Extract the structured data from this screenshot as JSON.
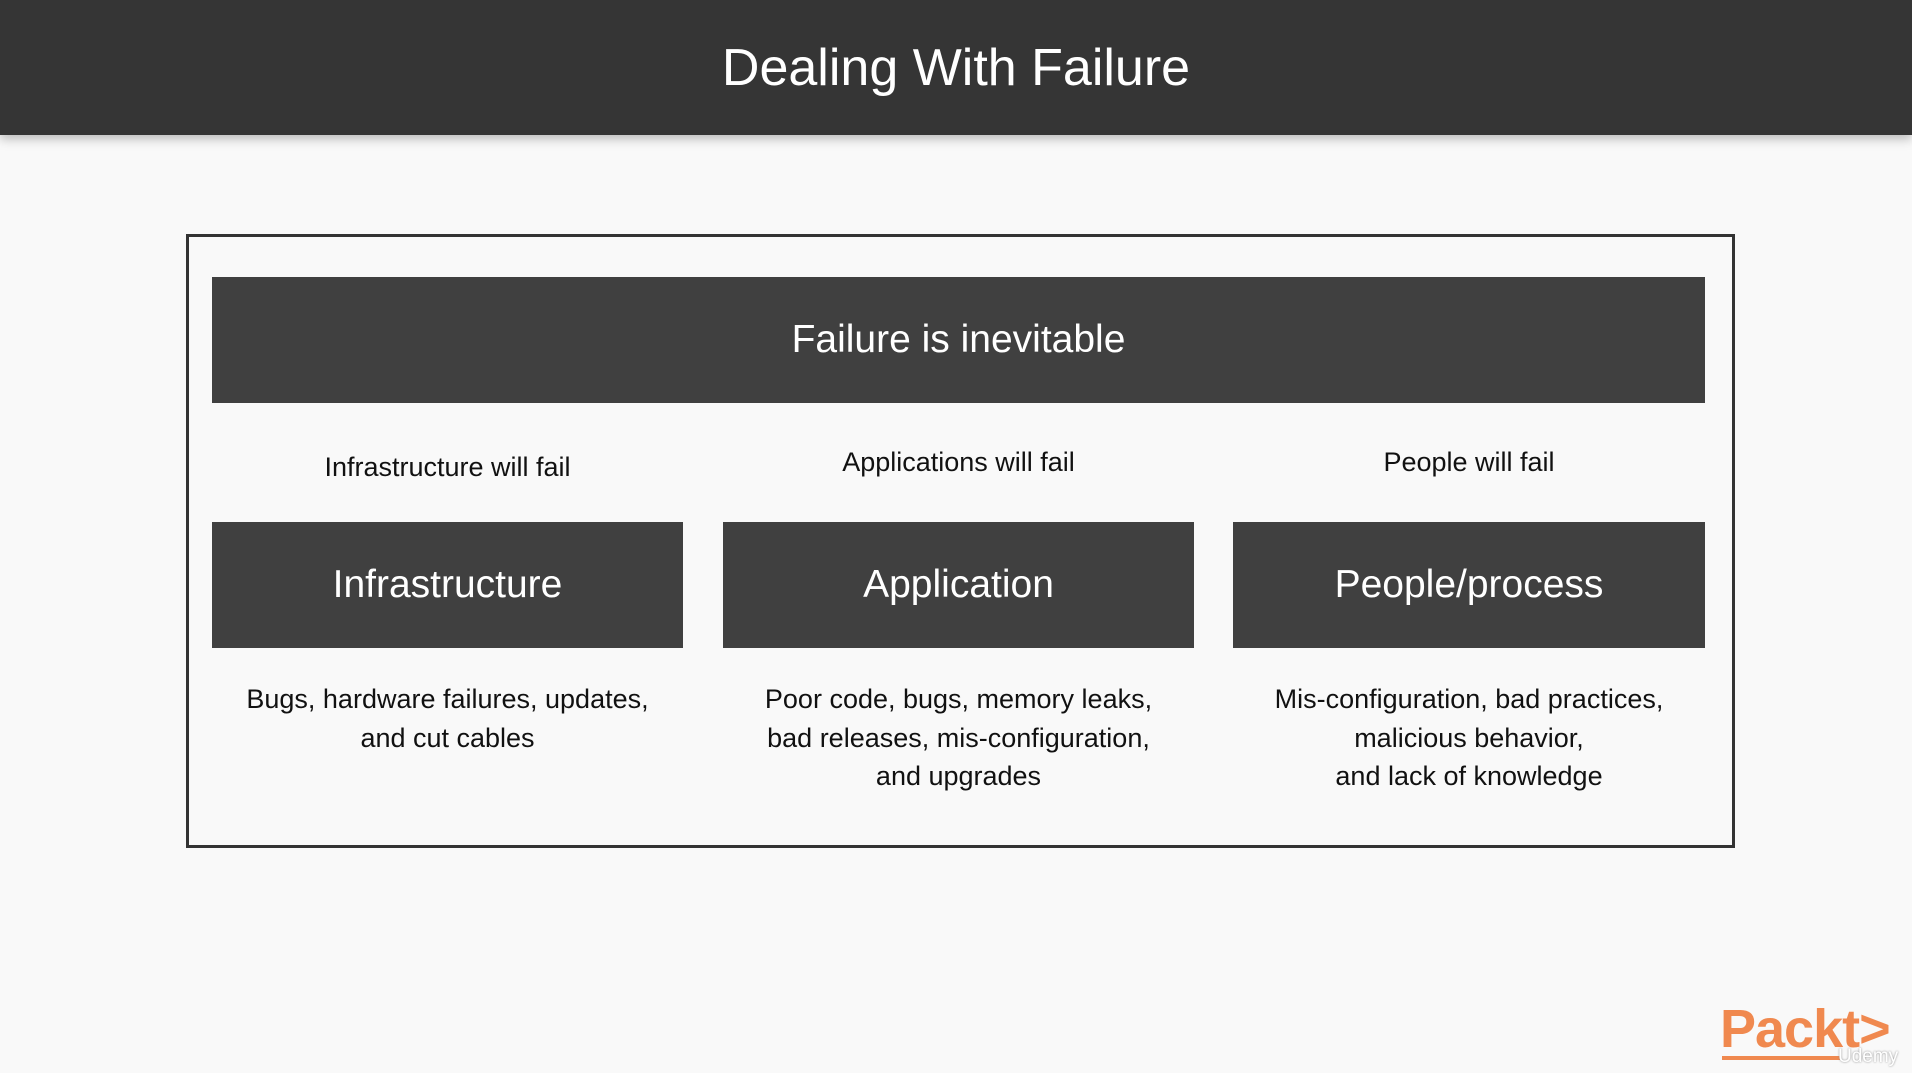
{
  "header": {
    "title": "Dealing With Failure"
  },
  "banner": {
    "text": "Failure is inevitable"
  },
  "columns": [
    {
      "label": "Infrastructure will fail",
      "box": "Infrastructure",
      "desc": [
        "Bugs, hardware failures, updates,",
        "and cut cables"
      ]
    },
    {
      "label": "Applications will fail",
      "box": "Application",
      "desc": [
        "Poor code, bugs, memory leaks,",
        "bad releases, mis-configuration,",
        "and upgrades"
      ]
    },
    {
      "label": "People will fail",
      "box": "People/process",
      "desc": [
        "Mis-configuration, bad practices,",
        "malicious behavior,",
        "and lack of knowledge"
      ]
    }
  ],
  "logo": {
    "brand": "Packt>",
    "overlay": "Udemy"
  },
  "colors": {
    "header": "#353535",
    "box": "#404040",
    "accent": "#f0894f"
  }
}
